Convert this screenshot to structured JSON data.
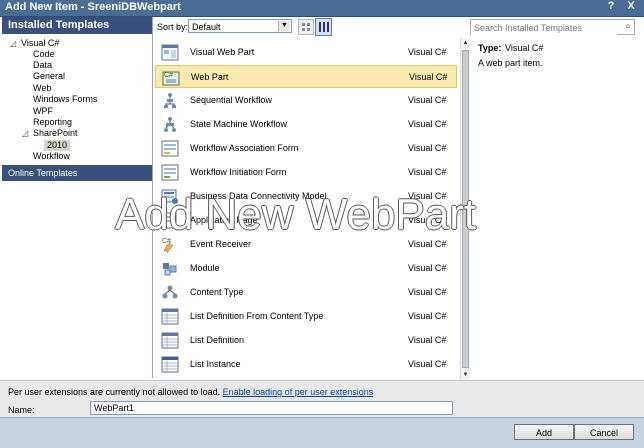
{
  "window": {
    "title": "Add New Item - SreeniDBWebpart",
    "help": "?",
    "close": "X"
  },
  "left": {
    "header": "Installed Templates",
    "tree": [
      {
        "label": "Visual C#",
        "toggle": "◿"
      },
      {
        "label": "Code"
      },
      {
        "label": "Data"
      },
      {
        "label": "General"
      },
      {
        "label": "Web"
      },
      {
        "label": "Windows Forms"
      },
      {
        "label": "WPF"
      },
      {
        "label": "Reporting"
      },
      {
        "label": "SharePoint",
        "toggle": "◿"
      },
      {
        "label": "2010"
      },
      {
        "label": "Workflow"
      }
    ],
    "online": "Online Templates"
  },
  "toolbar": {
    "sort_label": "Sort by:",
    "sort_value": "Default",
    "search_placeholder": "Search Installed Templates",
    "search_icon": "⌕"
  },
  "templates": [
    {
      "name": "Visual Web Part",
      "lang": "Visual C#",
      "icon": "visual-web-part-icon"
    },
    {
      "name": "Web Part",
      "lang": "Visual C#",
      "icon": "web-part-icon",
      "selected": true
    },
    {
      "name": "Sequential Workflow",
      "lang": "Visual C#",
      "icon": "sequential-workflow-icon"
    },
    {
      "name": "State Machine Workflow",
      "lang": "Visual C#",
      "icon": "state-machine-workflow-icon"
    },
    {
      "name": "Workflow Association Form",
      "lang": "Visual C#",
      "icon": "workflow-association-form-icon"
    },
    {
      "name": "Workflow Initiation Form",
      "lang": "Visual C#",
      "icon": "workflow-initiation-form-icon"
    },
    {
      "name": "Business Data Connectivity Model",
      "lang": "Visual C#",
      "icon": "bdc-model-icon"
    },
    {
      "name": "Application Page",
      "lang": "Visual C#",
      "icon": "application-page-icon"
    },
    {
      "name": "Event Receiver",
      "lang": "Visual C#",
      "icon": "event-receiver-icon"
    },
    {
      "name": "Module",
      "lang": "Visual C#",
      "icon": "module-icon"
    },
    {
      "name": "Content Type",
      "lang": "Visual C#",
      "icon": "content-type-icon"
    },
    {
      "name": "List Definition From Content Type",
      "lang": "Visual C#",
      "icon": "list-def-content-type-icon"
    },
    {
      "name": "List Definition",
      "lang": "Visual C#",
      "icon": "list-definition-icon"
    },
    {
      "name": "List Instance",
      "lang": "Visual C#",
      "icon": "list-instance-icon"
    }
  ],
  "details": {
    "type_label": "Type:",
    "type_value": "Visual C#",
    "description": "A web part item."
  },
  "watermark": "Add New WebPart",
  "bottom": {
    "ext_message": "Per user extensions are currently not allowed to load.",
    "ext_link": "Enable loading of per user extensions",
    "name_label": "Name:",
    "name_value": "WebPart1",
    "add_label": "Add",
    "cancel_label": "Cancel"
  },
  "colors": {
    "title_bar": "#4a6d96",
    "header_blue": "#38507a",
    "selection": "#fbeab0",
    "link": "#0645ad"
  }
}
